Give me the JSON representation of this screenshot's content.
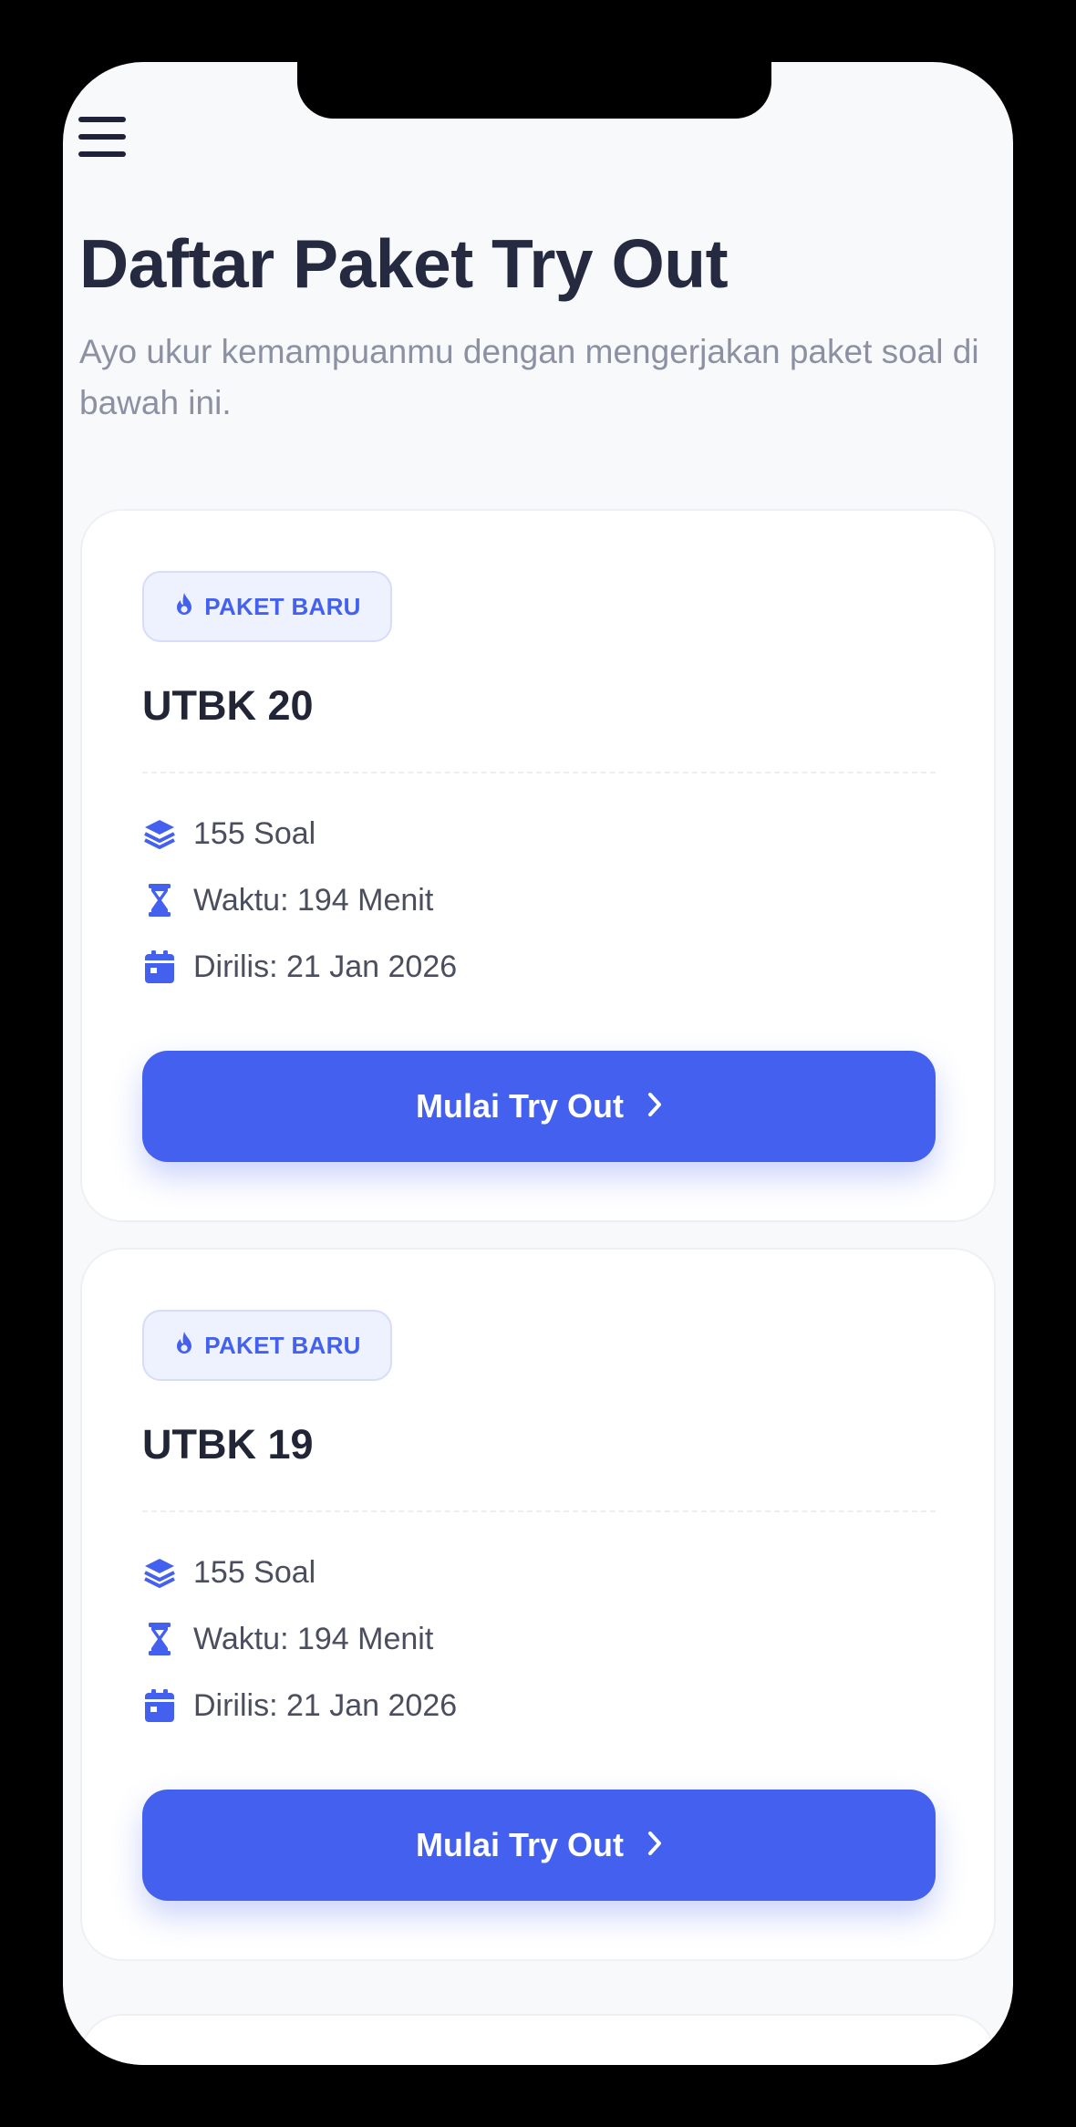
{
  "header": {
    "menu_icon": "hamburger-icon",
    "title": "Daftar Paket Try Out",
    "subtitle": "Ayo ukur kemampuanmu dengan mengerjakan paket soal di bawah ini."
  },
  "colors": {
    "accent": "#4361ee",
    "title": "#262a40",
    "subtitle": "#8b91a3",
    "badge_bg": "#eef1fe",
    "page_bg": "#f8f9fb"
  },
  "packages": [
    {
      "badge": "PAKET BARU",
      "badge_icon": "fire-icon",
      "title": "UTBK 20",
      "questions": "155 Soal",
      "questions_icon": "layers-icon",
      "duration": "Waktu: 194 Menit",
      "duration_icon": "hourglass-icon",
      "released": "Dirilis: 21 Jan 2026",
      "released_icon": "calendar-icon",
      "button_label": "Mulai Try Out",
      "button_icon": "chevron-right-icon"
    },
    {
      "badge": "PAKET BARU",
      "badge_icon": "fire-icon",
      "title": "UTBK 19",
      "questions": "155 Soal",
      "questions_icon": "layers-icon",
      "duration": "Waktu: 194 Menit",
      "duration_icon": "hourglass-icon",
      "released": "Dirilis: 21 Jan 2026",
      "released_icon": "calendar-icon",
      "button_label": "Mulai Try Out",
      "button_icon": "chevron-right-icon"
    }
  ]
}
